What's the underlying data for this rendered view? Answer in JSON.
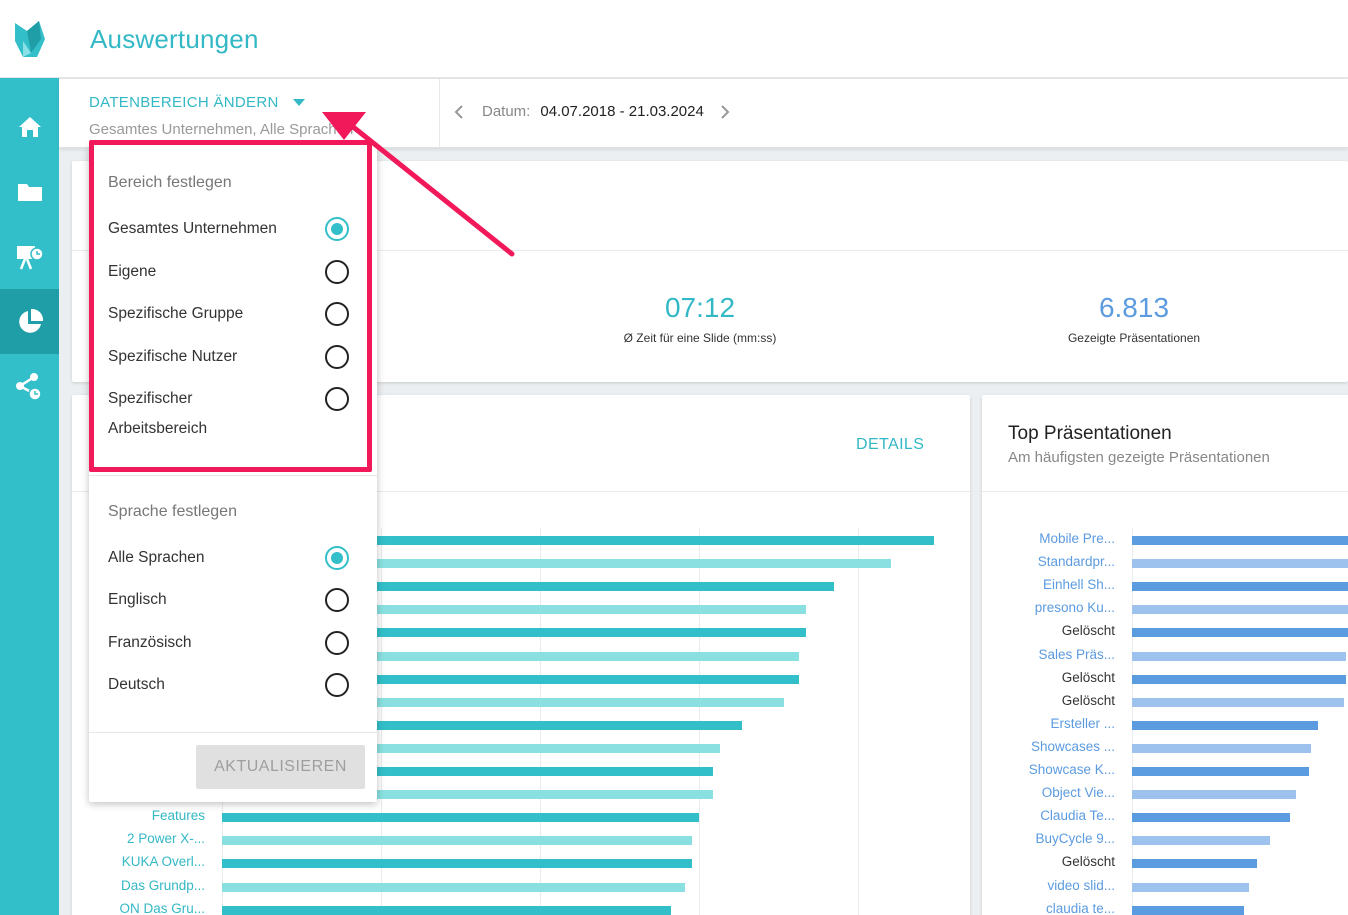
{
  "app": {
    "title": "Auswertungen"
  },
  "colors": {
    "accent": "#33bfc9",
    "accent_dark": "#1f9ea8",
    "blue": "#5b9be0",
    "highlight": "#f2195b"
  },
  "sidebar": {
    "items": [
      {
        "name": "home",
        "icon": "home-icon",
        "active": false
      },
      {
        "name": "folder",
        "icon": "folder-icon",
        "active": false
      },
      {
        "name": "presentations",
        "icon": "presentation-clock-icon",
        "active": false
      },
      {
        "name": "analytics",
        "icon": "pie-chart-icon",
        "active": true
      },
      {
        "name": "share",
        "icon": "share-clock-icon",
        "active": false
      }
    ]
  },
  "filter": {
    "range_label": "DATENBEREICH ÄNDERN",
    "range_summary": "Gesamtes Unternehmen, Alle Sprachen",
    "date_label": "Datum:",
    "date_value": "04.07.2018 - 21.03.2024"
  },
  "kpis": [
    {
      "value": "07:12",
      "label": "Ø Zeit für eine Slide (mm:ss)"
    },
    {
      "value": "6.813",
      "label": "Gezeigte Präsentationen"
    }
  ],
  "details_label": "DETAILS",
  "top_card": {
    "title": "Top Präsentationen",
    "subtitle": "Am häufigsten gezeigte Präsentationen"
  },
  "dropdown": {
    "scope_heading": "Bereich festlegen",
    "scope_options": [
      {
        "label": "Gesamtes Unternehmen",
        "checked": true
      },
      {
        "label": "Eigene",
        "checked": false
      },
      {
        "label": "Spezifische Gruppe",
        "checked": false
      },
      {
        "label": "Spezifische Nutzer",
        "checked": false
      },
      {
        "label": "Spezifischer",
        "label2": "Arbeitsbereich",
        "checked": false
      }
    ],
    "lang_heading": "Sprache festlegen",
    "lang_options": [
      {
        "label": "Alle Sprachen",
        "checked": true
      },
      {
        "label": "Englisch",
        "checked": false
      },
      {
        "label": "Französisch",
        "checked": false
      },
      {
        "label": "Deutsch",
        "checked": false
      }
    ],
    "update_label": "AKTUALISIEREN"
  },
  "chart_data": [
    {
      "type": "bar",
      "orientation": "horizontal",
      "categories": [
        "",
        "",
        "",
        "",
        "",
        "",
        "",
        "",
        "",
        "",
        "",
        "",
        "Features",
        "2 Power X-...",
        "KUKA Overl...",
        "Das Grundp...",
        "ON Das Gru..."
      ],
      "values": [
        100,
        94,
        86,
        82,
        82,
        81,
        81,
        79,
        73,
        70,
        69,
        69,
        67,
        66,
        66,
        65,
        63
      ]
    },
    {
      "type": "bar",
      "orientation": "horizontal",
      "title": "Top Präsentationen",
      "categories": [
        "Mobile Pre...",
        "Standardpr...",
        "Einhell Sh...",
        "presono Ku...",
        "Gelöscht",
        "Sales Präs...",
        "Gelöscht",
        "Gelöscht",
        "Ersteller ...",
        "Showcases ...",
        "Showcase K...",
        "Object Vie...",
        "Claudia Te...",
        "BuyCycle 9...",
        "Gelöscht",
        "video slid...",
        "claudia te..."
      ],
      "values": [
        100,
        100,
        100,
        100,
        100,
        99,
        99,
        98,
        86,
        83,
        82,
        76,
        73,
        64,
        58,
        54,
        52
      ]
    }
  ]
}
